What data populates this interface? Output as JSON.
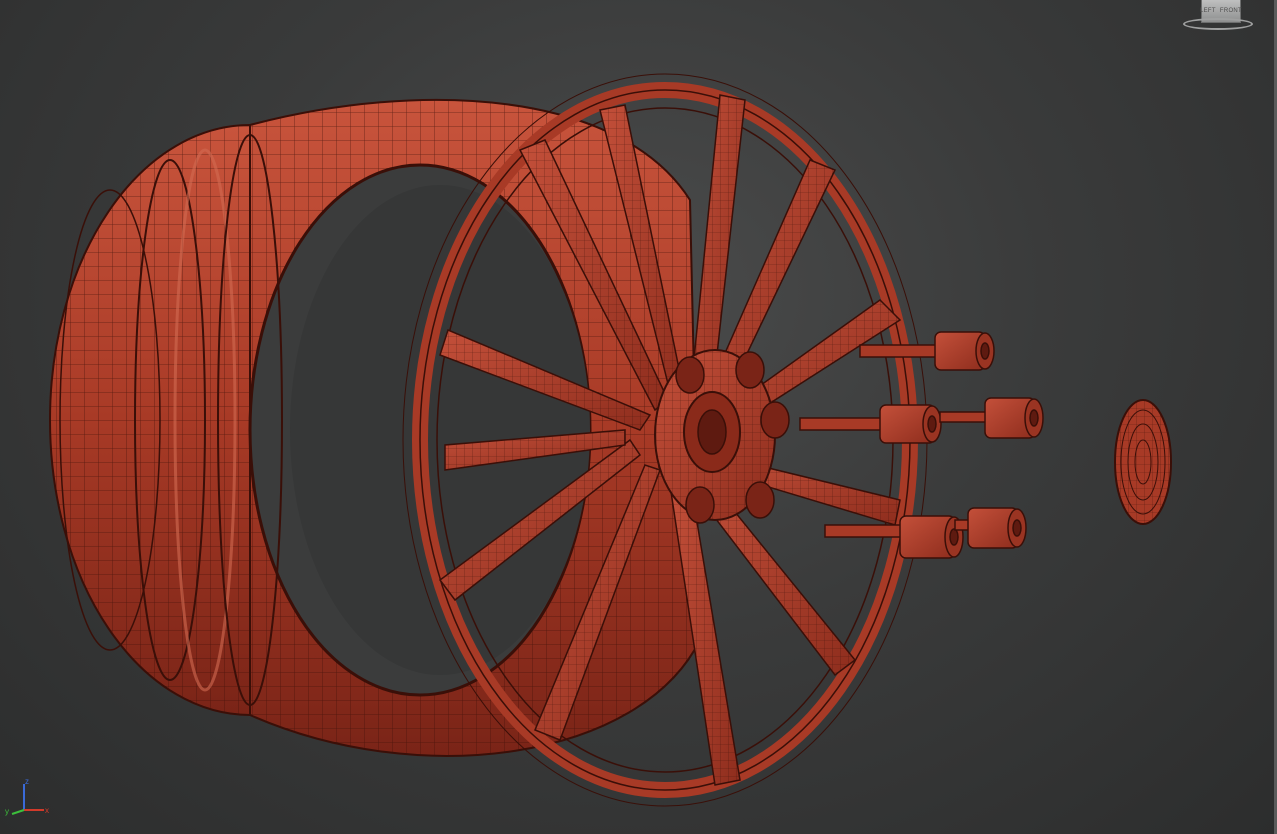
{
  "viewport": {
    "name": "perspective-viewport",
    "background": "#3a3b3b",
    "model_color": "#b0402d",
    "wire_color": "#3a0f08"
  },
  "viewcube": {
    "left_label": "LEFT",
    "front_label": "FRONT"
  },
  "axis_tripod": {
    "z_label": "z",
    "x_label": "x",
    "y_label": "y",
    "x_color": "#d23a2a",
    "y_color": "#3cbf3c",
    "z_color": "#3a6ad8"
  },
  "objects": [
    {
      "icon": "rim-barrel"
    },
    {
      "icon": "wheel-face-spokes"
    },
    {
      "icon": "lug-bolt"
    },
    {
      "icon": "center-cap"
    }
  ]
}
